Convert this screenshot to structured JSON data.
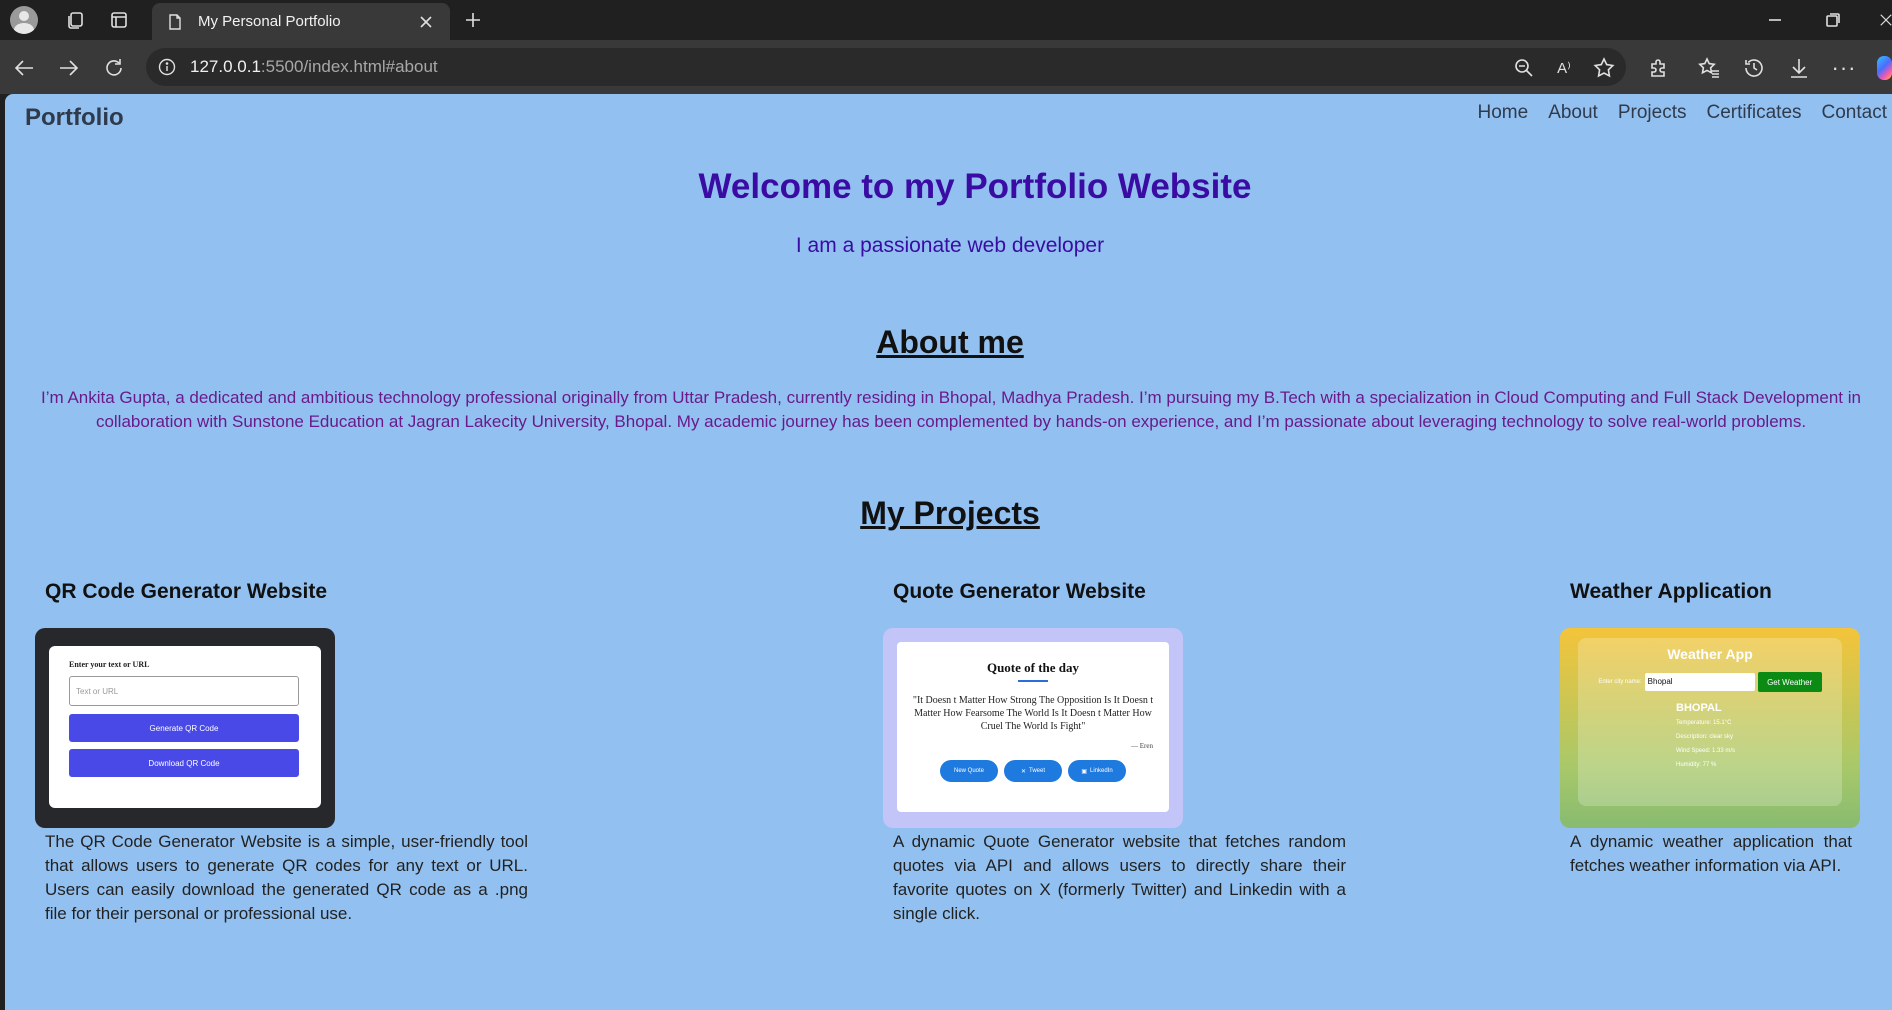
{
  "browser": {
    "tab_title": "My Personal Portfolio",
    "url_host": "127.0.0.1",
    "url_rest": ":5500/index.html#about",
    "read_aloud_glyph": "A⁾",
    "more_glyph": "···",
    "icons": [
      "profile-icon",
      "collections-icon",
      "tab-actions-icon",
      "page-icon",
      "close-icon",
      "new-tab-icon",
      "minimize-icon",
      "maximize-icon",
      "window-close-icon",
      "back-icon",
      "forward-icon",
      "refresh-icon",
      "site-info-icon",
      "zoom-icon",
      "read-aloud-icon",
      "favorite-star-icon",
      "extensions-icon",
      "favorites-icon",
      "history-icon",
      "download-icon",
      "more-icon",
      "copilot-icon"
    ]
  },
  "page": {
    "background": "#92c1f1",
    "brand": "Portfolio",
    "nav": [
      "Home",
      "About",
      "Projects",
      "Certificates",
      "Contact"
    ],
    "hero": {
      "title": "Welcome to my Portfolio Website",
      "subtitle": "I am a passionate web developer",
      "color": "#3a0ca3"
    },
    "about": {
      "title": "About me",
      "text": "I’m Ankita Gupta, a dedicated and ambitious technology professional originally from Uttar Pradesh, currently residing in Bhopal, Madhya Pradesh. I’m pursuing my B.Tech with a specialization in Cloud Computing and Full Stack Development in collaboration with Sunstone Education at Jagran Lakecity University, Bhopal. My academic journey has been complemented by hands-on experience, and I’m passionate about leveraging technology to solve real-world problems."
    },
    "projects": {
      "title": "My Projects",
      "items": [
        {
          "title": "QR Code Generator Website",
          "desc": "The QR Code Generator Website is a simple, user-friendly tool that allows users to generate QR codes for any text or URL. Users can easily download the generated QR code as a .png file for their personal or professional use.",
          "thumb": {
            "label": "Enter your text or URL",
            "placeholder": "Text or URL",
            "btn1": "Generate QR Code",
            "btn2": "Download QR Code"
          }
        },
        {
          "title": "Quote Generator Website",
          "desc": "A dynamic Quote Generator website that fetches random quotes via API and allows users to directly share their favorite quotes on X (formerly Twitter) and Linkedin with a single click.",
          "thumb": {
            "heading": "Quote of the day",
            "quote": "\"It Doesn t Matter How Strong The Opposition Is It Doesn t Matter How Fearsome The World Is It Doesn t Matter How Cruel The World Is Fight\"",
            "author": "— Eren",
            "btn1": "New Quote",
            "btn2": "Tweet",
            "btn2_icon": "✕",
            "btn3": "LinkedIn",
            "btn3_icon": "▣"
          }
        },
        {
          "title": "Weather Application",
          "desc": "A dynamic weather application that fetches weather information via API.",
          "thumb": {
            "title": "Weather App",
            "input_label": "Enter city name:",
            "input_value": "Bhopal",
            "button": "Get Weather",
            "city": "BHOPAL",
            "temperature": "Temperature: 15.1°C",
            "description": "Description: clear sky",
            "wind": "Wind Speed: 1.33 m/s",
            "humidity": "Humidity: 77 %"
          }
        }
      ]
    }
  }
}
